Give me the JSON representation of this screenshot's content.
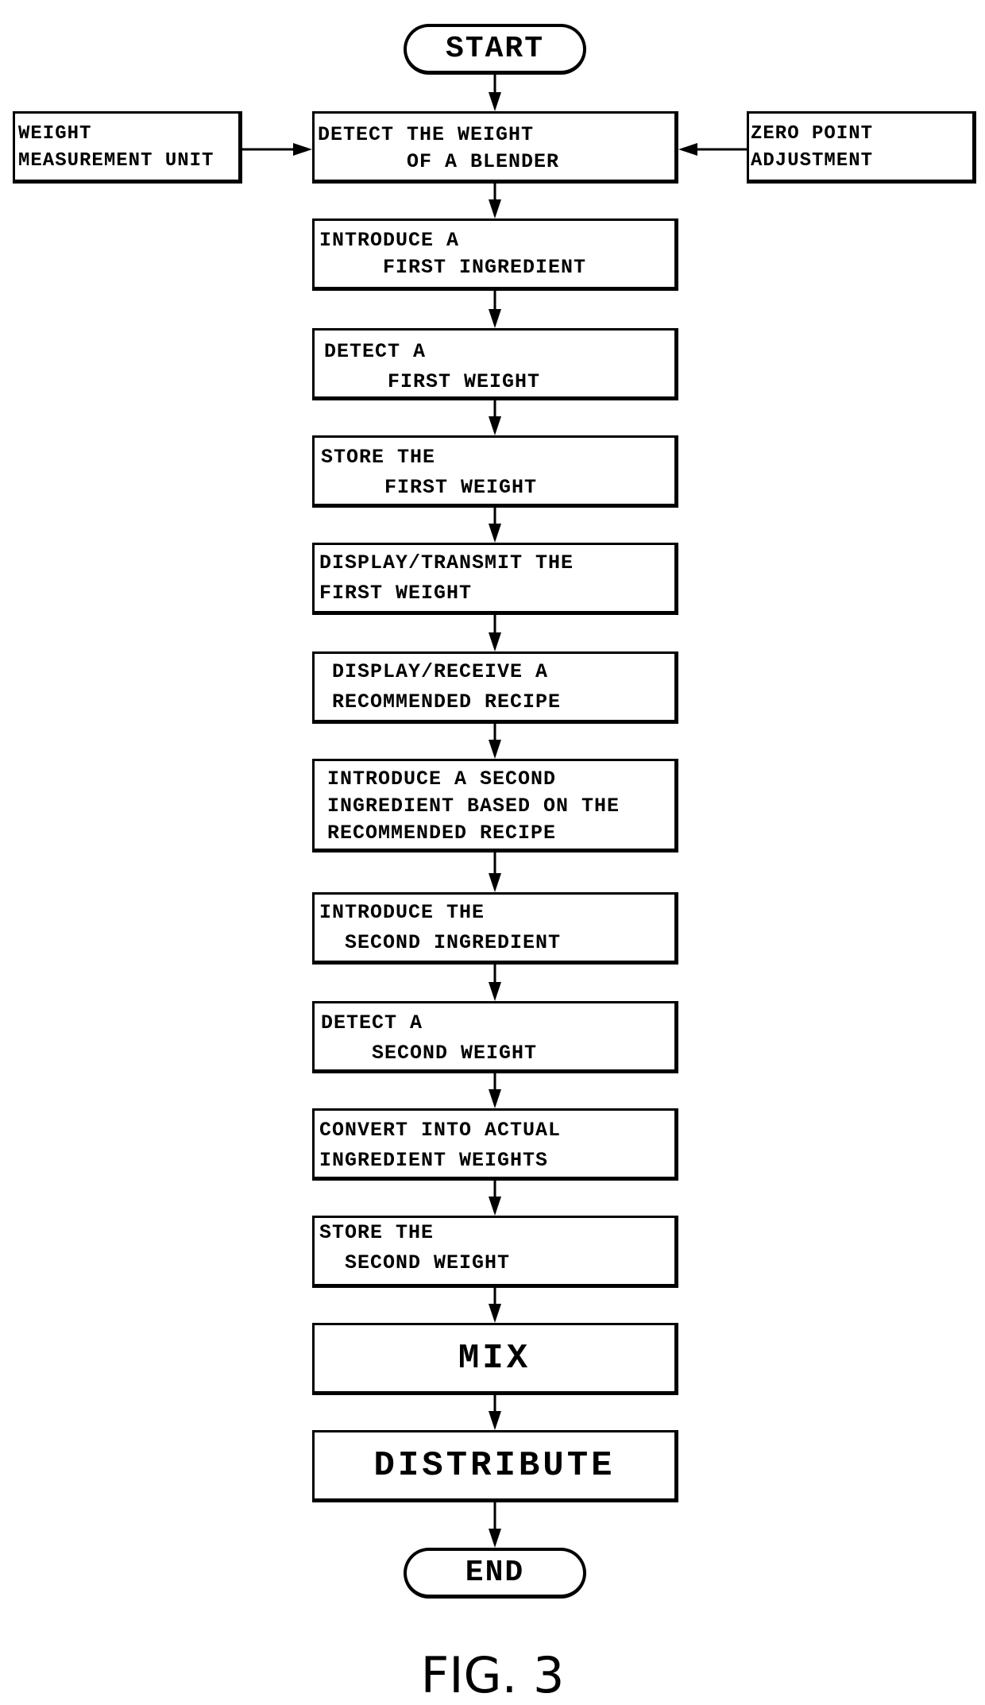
{
  "diagram": {
    "type": "flowchart",
    "start_label": "START",
    "end_label": "END",
    "side_inputs": {
      "left": {
        "lines": [
          "WEIGHT",
          "MEASUREMENT UNIT"
        ]
      },
      "right": {
        "lines": [
          "ZERO POINT",
          "ADJUSTMENT"
        ]
      }
    },
    "steps": [
      {
        "lines": [
          "DETECT THE WEIGHT",
          "       OF A BLENDER"
        ]
      },
      {
        "lines": [
          "INTRODUCE A",
          "     FIRST INGREDIENT"
        ]
      },
      {
        "lines": [
          "DETECT A",
          "     FIRST WEIGHT"
        ]
      },
      {
        "lines": [
          "STORE THE",
          "     FIRST WEIGHT"
        ]
      },
      {
        "lines": [
          "DISPLAY/TRANSMIT THE",
          "FIRST WEIGHT"
        ]
      },
      {
        "lines": [
          "DISPLAY/RECEIVE A",
          "RECOMMENDED RECIPE"
        ]
      },
      {
        "lines": [
          "INTRODUCE A SECOND",
          "INGREDIENT BASED ON THE",
          "RECOMMENDED RECIPE"
        ]
      },
      {
        "lines": [
          "INTRODUCE THE",
          "  SECOND INGREDIENT"
        ]
      },
      {
        "lines": [
          "DETECT A",
          "    SECOND WEIGHT"
        ]
      },
      {
        "lines": [
          "CONVERT INTO ACTUAL",
          "INGREDIENT WEIGHTS"
        ]
      },
      {
        "lines": [
          "STORE THE",
          "  SECOND WEIGHT"
        ]
      },
      {
        "lines": [
          "MIX"
        ]
      },
      {
        "lines": [
          "DISTRIBUTE"
        ]
      }
    ],
    "edges": [
      [
        "start",
        "step-1"
      ],
      [
        "weight-measurement-unit",
        "step-1"
      ],
      [
        "zero-point-adjustment",
        "step-1"
      ],
      [
        "step-1",
        "step-2"
      ],
      [
        "step-2",
        "step-3"
      ],
      [
        "step-3",
        "step-4"
      ],
      [
        "step-4",
        "step-5"
      ],
      [
        "step-5",
        "step-6"
      ],
      [
        "step-6",
        "step-7"
      ],
      [
        "step-7",
        "step-8"
      ],
      [
        "step-8",
        "step-9"
      ],
      [
        "step-9",
        "step-10"
      ],
      [
        "step-10",
        "step-11"
      ],
      [
        "step-11",
        "step-12"
      ],
      [
        "step-12",
        "step-13"
      ],
      [
        "step-13",
        "end"
      ]
    ]
  },
  "figure_label": "FIG. 3"
}
